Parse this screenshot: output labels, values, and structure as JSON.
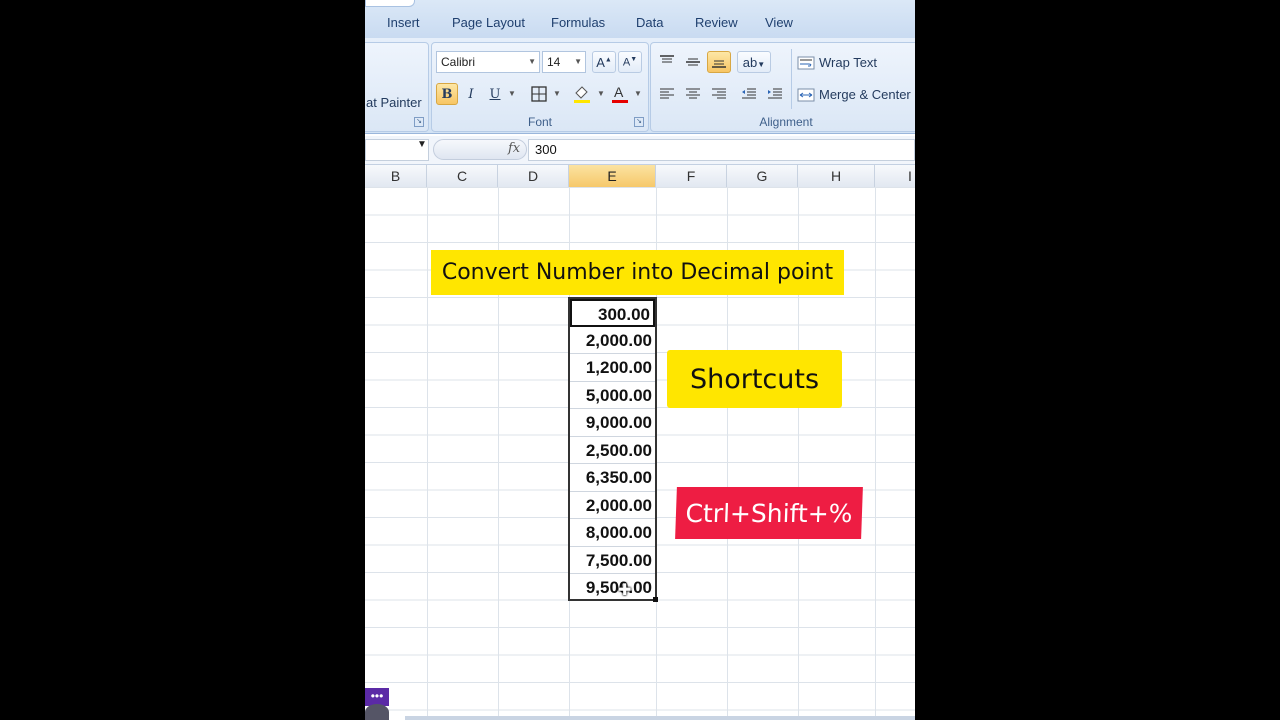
{
  "ribbon": {
    "tabs": [
      "Insert",
      "Page Layout",
      "Formulas",
      "Data",
      "Review",
      "View"
    ],
    "clipboard": {
      "format_painter_label": "at Painter"
    },
    "font_group": {
      "label": "Font",
      "font_name": "Calibri",
      "font_size": "14",
      "bold": "B",
      "italic": "I",
      "underline": "U"
    },
    "alignment_group": {
      "label": "Alignment",
      "wrap_text": "Wrap Text",
      "merge_center": "Merge & Center"
    }
  },
  "formula_bar": {
    "fx": "fx",
    "value": "300"
  },
  "columns": [
    "B",
    "C",
    "D",
    "E",
    "F",
    "G",
    "H",
    "I"
  ],
  "selected_column": "E",
  "callouts": {
    "title": "Convert Number into Decimal point",
    "shortcuts": "Shortcuts",
    "keys": "Ctrl+Shift+%"
  },
  "cells": [
    "300.00",
    "2,000.00",
    "1,200.00",
    "5,000.00",
    "9,000.00",
    "2,500.00",
    "6,350.00",
    "2,000.00",
    "8,000.00",
    "7,500.00",
    "9,500.00"
  ],
  "bottom": {
    "more": "•••"
  },
  "colors": {
    "highlight": "#ffe600",
    "shortcut_red": "#ee1d43",
    "selected_header": "#f6c86a"
  }
}
